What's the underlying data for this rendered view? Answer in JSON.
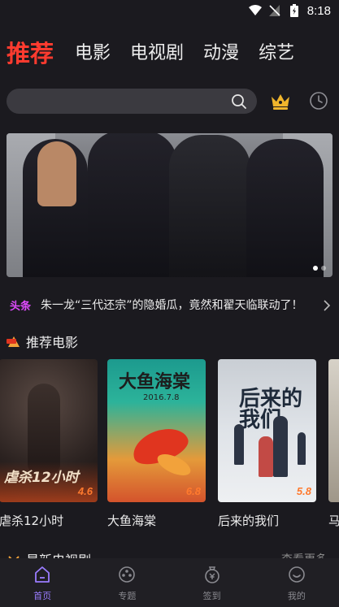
{
  "status_bar": {
    "time": "8:18"
  },
  "tabs": [
    {
      "label": "推荐",
      "active": true
    },
    {
      "label": "电影",
      "active": false
    },
    {
      "label": "电视剧",
      "active": false
    },
    {
      "label": "动漫",
      "active": false
    },
    {
      "label": "综艺",
      "active": false
    }
  ],
  "search": {
    "placeholder": "",
    "icons": [
      "search-icon",
      "crown-icon",
      "history-icon"
    ]
  },
  "banner": {
    "slide_count": 2,
    "active_slide": 0
  },
  "headline": {
    "tag": "头条",
    "text": "朱一龙“三代还宗”的隐婚瓜，竟然和翟天临联动了！"
  },
  "sections": {
    "movies": {
      "label": "推荐电影"
    },
    "tv": {
      "label": "最新电视剧",
      "more": "查看更多"
    }
  },
  "movies": [
    {
      "title": "虐杀12小时",
      "poster_text": "虐杀12小时",
      "rating": "4.6"
    },
    {
      "title": "大鱼海棠",
      "poster_text": "大鱼海棠",
      "poster_date": "2016.7.8",
      "rating": "6.8"
    },
    {
      "title": "后来的我们",
      "poster_text": "后来的我们",
      "rating": "5.8"
    },
    {
      "title": "马"
    }
  ],
  "bottom_nav": [
    {
      "label": "首页",
      "icon": "home-icon",
      "active": true
    },
    {
      "label": "专题",
      "icon": "topic-icon",
      "active": false
    },
    {
      "label": "签到",
      "icon": "checkin-icon",
      "active": false
    },
    {
      "label": "我的",
      "icon": "profile-icon",
      "active": false
    }
  ],
  "colors": {
    "accent_red": "#ff3b2f",
    "accent_purple": "#9a7cff",
    "headline_tag": "#e04cff",
    "background": "#1b1a1f"
  }
}
